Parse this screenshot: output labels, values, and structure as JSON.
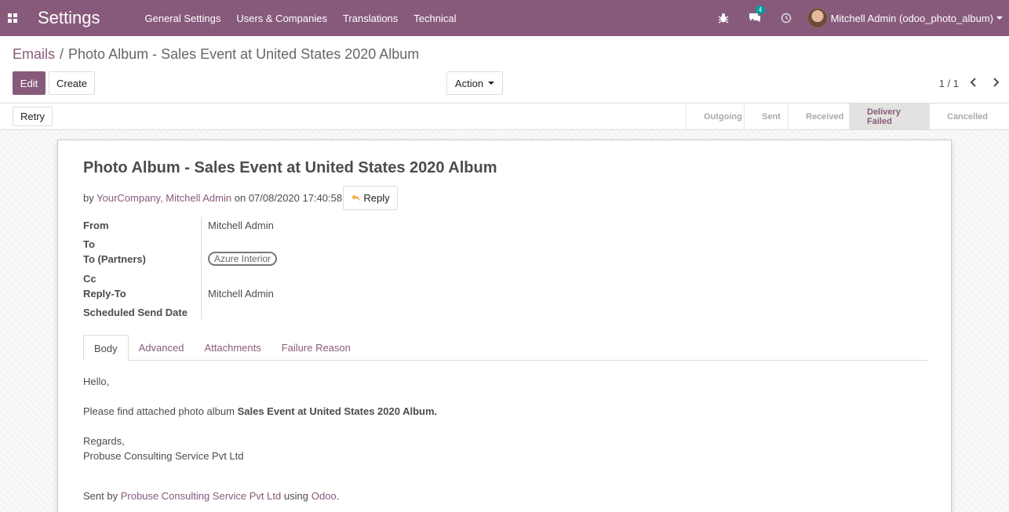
{
  "navbar": {
    "app_title": "Settings",
    "menu": [
      "General Settings",
      "Users & Companies",
      "Translations",
      "Technical"
    ],
    "messages_badge": "4",
    "user_name": "Mitchell Admin (odoo_photo_album)"
  },
  "breadcrumb": {
    "parent": "Emails",
    "separator": "/",
    "current": "Photo Album - Sales Event at United States 2020 Album"
  },
  "buttons": {
    "edit": "Edit",
    "create": "Create",
    "action": "Action",
    "retry": "Retry"
  },
  "pager": {
    "value": "1 / 1"
  },
  "stages": [
    "Outgoing",
    "Sent",
    "Received",
    "Delivery Failed",
    "Cancelled"
  ],
  "active_stage": "Delivery Failed",
  "mail": {
    "subject": "Photo Album - Sales Event at United States 2020 Album",
    "by_prefix": "by",
    "author": "YourCompany, Mitchell Admin",
    "on_text": "on",
    "date": "07/08/2020 17:40:58",
    "reply_label": "Reply"
  },
  "fields": {
    "from_label": "From",
    "from_value": "Mitchell Admin",
    "to_label": "To",
    "to_partners_label": "To (Partners)",
    "to_partners_tag": "Azure Interior",
    "cc_label": "Cc",
    "reply_to_label": "Reply-To",
    "reply_to_value": "Mitchell Admin",
    "scheduled_label": "Scheduled Send Date"
  },
  "tabs": [
    "Body",
    "Advanced",
    "Attachments",
    "Failure Reason"
  ],
  "body": {
    "greeting": "Hello,",
    "line_prefix": "Please find attached photo album",
    "album_name": "Sales Event at United States 2020 Album.",
    "regards": "Regards,",
    "company": "Probuse Consulting Service Pvt Ltd",
    "sent_by": "Sent by",
    "sender": "Probuse Consulting Service Pvt Ltd",
    "using": "using",
    "platform": "Odoo",
    "end": "."
  },
  "colors": {
    "brand": "#875a7b",
    "badge": "#00a09d"
  }
}
